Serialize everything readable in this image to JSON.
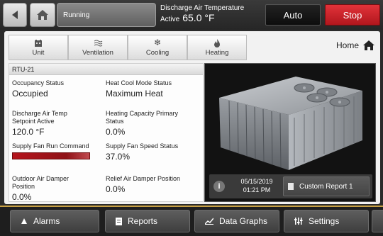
{
  "topbar": {
    "status_text": "Running",
    "discharge_label": "Discharge Air Temperature",
    "discharge_sub": "Active",
    "discharge_value": "65.0 °F",
    "auto_label": "Auto",
    "stop_label": "Stop"
  },
  "tabs": [
    {
      "label": "Unit",
      "icon": "unit-icon"
    },
    {
      "label": "Ventilation",
      "icon": "ventilation-icon"
    },
    {
      "label": "Cooling",
      "icon": "snowflake-icon"
    },
    {
      "label": "Heating",
      "icon": "flame-icon"
    }
  ],
  "home": {
    "label": "Home"
  },
  "panel": {
    "title": "RTU-21",
    "occupancy_label": "Occupancy Status",
    "occupancy_value": "Occupied",
    "heatcool_label": "Heat Cool Mode Status",
    "heatcool_value": "Maximum Heat",
    "dat_setpoint_label_1": "Discharge Air Temp",
    "dat_setpoint_label_2": "Setpoint Active",
    "dat_setpoint_value": "120.0 °F",
    "heat_cap_label_1": "Heating Capacity Primary",
    "heat_cap_label_2": "Status",
    "heat_cap_value": "0.0%",
    "fan_run_label": "Supply Fan Run Command",
    "fan_speed_label": "Supply Fan Speed Status",
    "fan_speed_value": "37.0%",
    "oa_damper_label_1": "Outdoor Air Damper",
    "oa_damper_label_2": "Position",
    "oa_damper_value": "0.0%",
    "relief_damper_label": "Relief Air Damper Position",
    "relief_damper_value": "0.0%"
  },
  "info": {
    "date": "05/15/2019",
    "time": "01:21 PM",
    "report_label": "Custom Report 1"
  },
  "nav": {
    "alarms": "Alarms",
    "reports": "Reports",
    "data_graphs": "Data Graphs",
    "settings": "Settings"
  },
  "colors": {
    "stop": "#d0242b",
    "accent_gold": "#c7a044",
    "run_bar": "#b5151d"
  }
}
